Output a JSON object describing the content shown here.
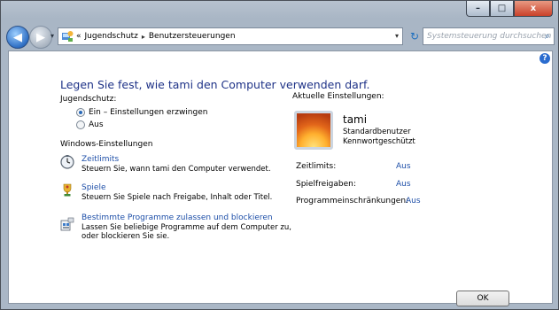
{
  "window": {
    "caption": {
      "minimize": "–",
      "maximize": "□",
      "close": "x"
    }
  },
  "nav": {
    "back_glyph": "◀",
    "forward_glyph": "▶",
    "breadcrumb_prefix": "«",
    "breadcrumb": [
      "Jugendschutz",
      "Benutzersteuerungen"
    ],
    "breadcrumb_sep": "▸",
    "dropdown_glyph": "▾",
    "refresh_glyph": "↻",
    "search_placeholder": "Systemsteuerung durchsuchen",
    "search_glyph": "⌕"
  },
  "main": {
    "help_glyph": "?",
    "title": "Legen Sie fest, wie tami den Computer verwenden darf.",
    "parental_controls_label": "Jugendschutz:",
    "option_on": "Ein – Einstellungen erzwingen",
    "option_off": "Aus",
    "selected_option": "on",
    "windows_settings_label": "Windows-Einstellungen",
    "settings": [
      {
        "title": "Zeitlimits",
        "desc": "Steuern Sie, wann tami den Computer verwendet.",
        "icon": "clock-icon"
      },
      {
        "title": "Spiele",
        "desc": "Steuern Sie Spiele nach Freigabe, Inhalt oder Titel.",
        "icon": "trophy-icon"
      },
      {
        "title": "Bestimmte Programme zulassen und blockieren",
        "desc": "Lassen Sie beliebige Programme auf dem Computer zu, oder blockieren Sie sie.",
        "icon": "program-icon"
      }
    ]
  },
  "current": {
    "label": "Aktuelle Einstellungen:",
    "user_name": "tami",
    "user_type": "Standardbenutzer",
    "user_password": "Kennwortgeschützt",
    "rows": [
      {
        "key": "Zeitlimits:",
        "value": "Aus"
      },
      {
        "key": "Spielfreigaben:",
        "value": "Aus"
      },
      {
        "key": "Programmeinschränkungen:",
        "value": "Aus"
      }
    ]
  },
  "footer": {
    "ok_label": "OK"
  },
  "colors": {
    "link": "#1e4fa8",
    "title": "#1e3287",
    "close_button": "#c9412a"
  }
}
